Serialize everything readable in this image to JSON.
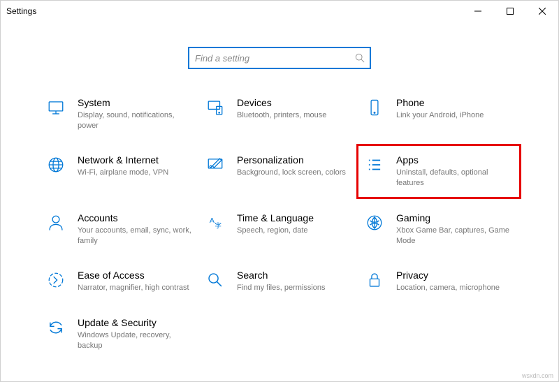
{
  "window": {
    "title": "Settings"
  },
  "search": {
    "placeholder": "Find a setting"
  },
  "tiles": {
    "system": {
      "title": "System",
      "desc": "Display, sound, notifications, power"
    },
    "devices": {
      "title": "Devices",
      "desc": "Bluetooth, printers, mouse"
    },
    "phone": {
      "title": "Phone",
      "desc": "Link your Android, iPhone"
    },
    "network": {
      "title": "Network & Internet",
      "desc": "Wi-Fi, airplane mode, VPN"
    },
    "personalization": {
      "title": "Personalization",
      "desc": "Background, lock screen, colors"
    },
    "apps": {
      "title": "Apps",
      "desc": "Uninstall, defaults, optional features"
    },
    "accounts": {
      "title": "Accounts",
      "desc": "Your accounts, email, sync, work, family"
    },
    "timelang": {
      "title": "Time & Language",
      "desc": "Speech, region, date"
    },
    "gaming": {
      "title": "Gaming",
      "desc": "Xbox Game Bar, captures, Game Mode"
    },
    "ease": {
      "title": "Ease of Access",
      "desc": "Narrator, magnifier, high contrast"
    },
    "search_tile": {
      "title": "Search",
      "desc": "Find my files, permissions"
    },
    "privacy": {
      "title": "Privacy",
      "desc": "Location, camera, microphone"
    },
    "update": {
      "title": "Update & Security",
      "desc": "Windows Update, recovery, backup"
    }
  },
  "highlighted_tile": "apps",
  "watermark": "wsxdn.com",
  "colors": {
    "accent": "#0078d7",
    "highlight_box": "#e60000"
  }
}
